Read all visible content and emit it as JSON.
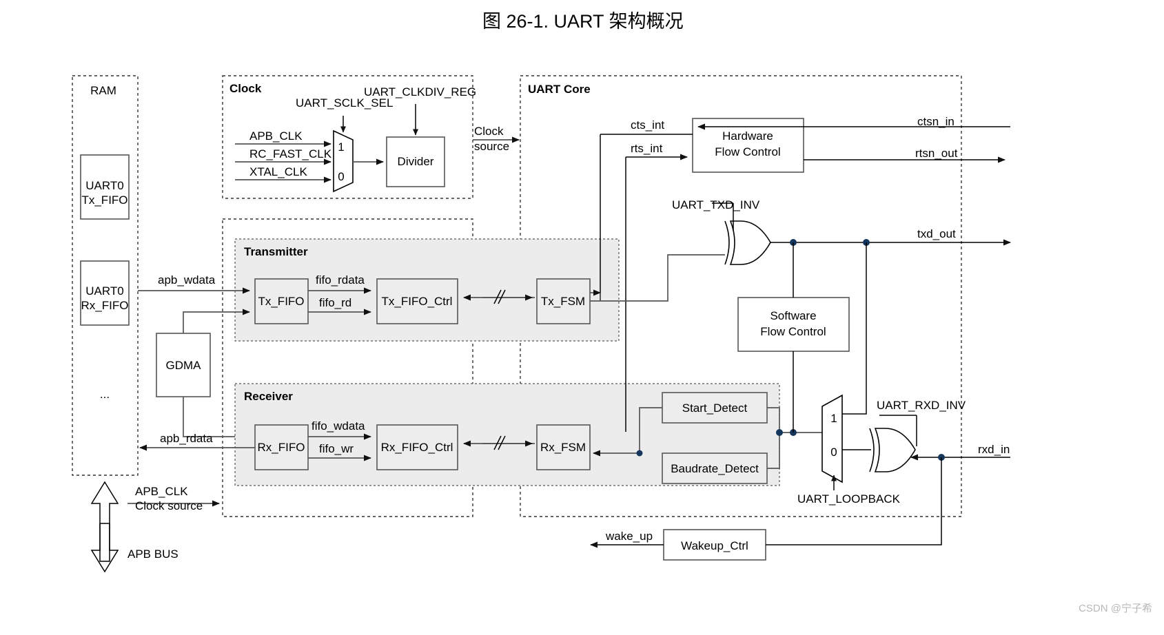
{
  "title": "图 26-1. UART 架构概况",
  "watermark": "CSDN @宁子希",
  "groups": {
    "ram": "RAM",
    "clock": "Clock",
    "uart_core": "UART Core",
    "transmitter": "Transmitter",
    "receiver": "Receiver"
  },
  "blocks": {
    "uart0_tx_fifo_l1": "UART0",
    "uart0_tx_fifo_l2": "Tx_FIFO",
    "uart0_rx_fifo_l1": "UART0",
    "uart0_rx_fifo_l2": "Rx_FIFO",
    "ram_ellipsis": "...",
    "gdma": "GDMA",
    "divider": "Divider",
    "tx_fifo": "Tx_FIFO",
    "tx_fifo_ctrl": "Tx_FIFO_Ctrl",
    "tx_fsm": "Tx_FSM",
    "rx_fifo": "Rx_FIFO",
    "rx_fifo_ctrl": "Rx_FIFO_Ctrl",
    "rx_fsm": "Rx_FSM",
    "hw_flow_l1": "Hardware",
    "hw_flow_l2": "Flow Control",
    "sw_flow_l1": "Software",
    "sw_flow_l2": "Flow Control",
    "start_detect": "Start_Detect",
    "baudrate_detect": "Baudrate_Detect",
    "wakeup_ctrl": "Wakeup_Ctrl"
  },
  "signals": {
    "apb_clk": "APB_CLK",
    "rc_fast_clk": "RC_FAST_CLK",
    "xtal_clk": "XTAL_CLK",
    "uart_sclk_sel": "UART_SCLK_SEL",
    "uart_clkdiv_reg": "UART_CLKDIV_REG",
    "clock_source_l1": "Clock",
    "clock_source_l2": "source",
    "apb_wdata": "apb_wdata",
    "apb_rdata": "apb_rdata",
    "fifo_rdata": "fifo_rdata",
    "fifo_rd": "fifo_rd",
    "fifo_wdata": "fifo_wdata",
    "fifo_wr": "fifo_wr",
    "cts_int": "cts_int",
    "rts_int": "rts_int",
    "ctsn_in": "ctsn_in",
    "rtsn_out": "rtsn_out",
    "txd_out": "txd_out",
    "rxd_in": "rxd_in",
    "wake_up": "wake_up",
    "uart_txd_inv": "UART_TXD_INV",
    "uart_rxd_inv": "UART_RXD_INV",
    "uart_loopback": "UART_LOOPBACK",
    "apb_bus_clk_l1": "APB_CLK",
    "apb_bus_clk_l2": "Clock source",
    "apb_bus": "APB BUS"
  },
  "mux": {
    "clk_sel_top": "1",
    "clk_sel_bottom": "0",
    "loopback_top": "1",
    "loopback_bottom": "0"
  },
  "colors": {
    "background": "#ffffff",
    "stroke": "#555555",
    "shaded_group": "#ececec",
    "junction": "#17365d",
    "watermark": "#b8b8b8"
  }
}
